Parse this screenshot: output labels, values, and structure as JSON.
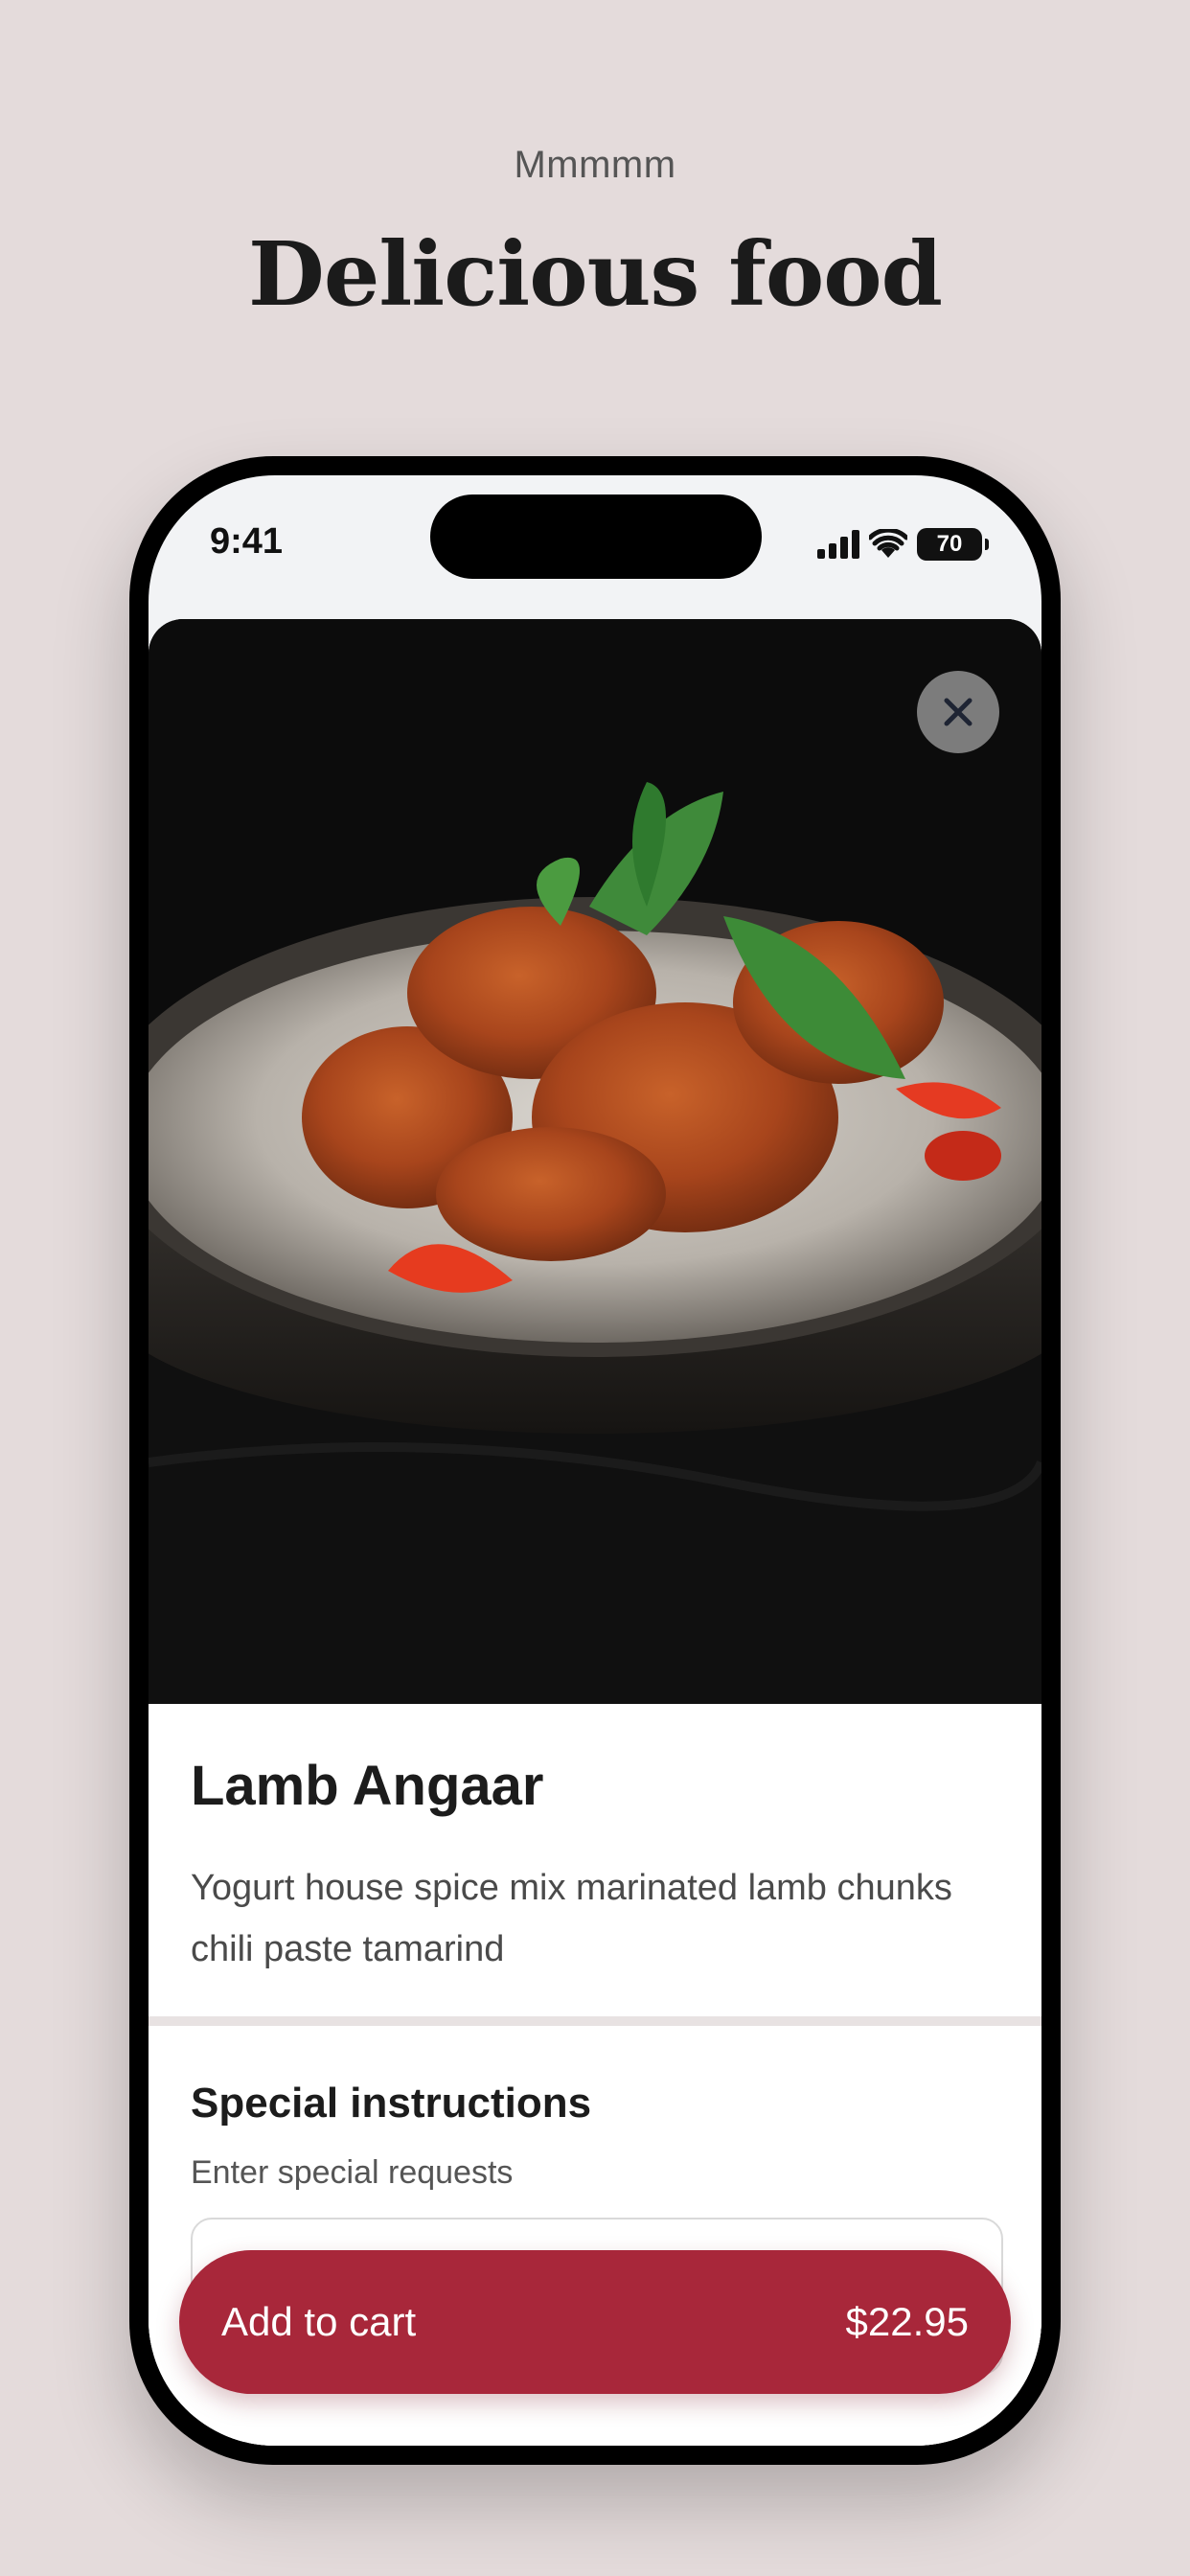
{
  "header": {
    "eyebrow": "Mmmmm",
    "title": "Delicious food"
  },
  "status_bar": {
    "time": "9:41",
    "battery": "70",
    "icons": [
      "signal-icon",
      "wifi-icon",
      "battery-icon"
    ]
  },
  "product": {
    "image_alt": "Lamb curry in a bowl with mint and tomato",
    "name": "Lamb Angaar",
    "description": "Yogurt house spice mix marinated lamb chunks chili paste tamarind",
    "close_icon": "close-icon"
  },
  "instructions": {
    "title": "Special instructions",
    "subtitle": "Enter special requests",
    "value": ""
  },
  "cart": {
    "label": "Add to cart",
    "price": "$22.95"
  },
  "colors": {
    "background": "#e4dbdb",
    "accent": "#a8273a",
    "text": "#1c1c1c"
  }
}
